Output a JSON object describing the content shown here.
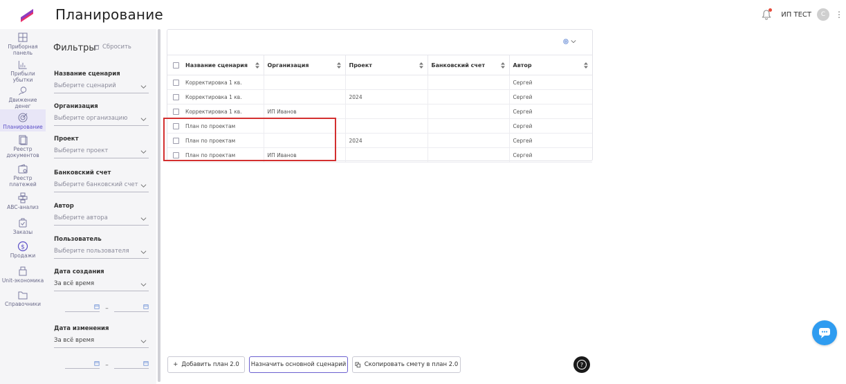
{
  "header": {
    "title": "Планирование",
    "user_name": "ИП ТЕСТ",
    "avatar_letter": "С"
  },
  "nav": {
    "items": [
      {
        "label": "Приборная панель",
        "icon": "dashboard-icon"
      },
      {
        "label": "Прибыли убытки",
        "icon": "chart-icon"
      },
      {
        "label": "Движение денег",
        "icon": "money-flow-icon"
      },
      {
        "label": "Планирование",
        "icon": "target-icon",
        "active": true
      },
      {
        "label": "Реестр документов",
        "icon": "documents-icon"
      },
      {
        "label": "Реестр платежей",
        "icon": "wallet-icon"
      },
      {
        "label": "ABC-анализ",
        "icon": "abc-icon"
      },
      {
        "label": "Заказы",
        "icon": "orders-icon"
      },
      {
        "label": "Продажи",
        "icon": "dollar-icon"
      },
      {
        "label": "Unit-экономика",
        "icon": "unit-icon"
      },
      {
        "label": "Справочники",
        "icon": "folder-icon"
      }
    ]
  },
  "filters": {
    "title": "Фильтры",
    "reset_label": "Сбросить",
    "scenario": {
      "label": "Название сценария",
      "placeholder": "Выберите сценарий"
    },
    "organization": {
      "label": "Организация",
      "placeholder": "Выберите организацию"
    },
    "project": {
      "label": "Проект",
      "placeholder": "Выберите проект"
    },
    "bank_account": {
      "label": "Банковский счет",
      "placeholder": "Выберите банковский счет"
    },
    "author": {
      "label": "Автор",
      "placeholder": "Выберите автора"
    },
    "user": {
      "label": "Пользователь",
      "placeholder": "Выберите пользователя"
    },
    "created": {
      "label": "Дата создания",
      "value": "За всё время",
      "dash": "–"
    },
    "modified": {
      "label": "Дата изменения",
      "value": "За всё время",
      "dash": "–"
    }
  },
  "table": {
    "columns": [
      "Название сценария",
      "Организация",
      "Проект",
      "Банковский счет",
      "Автор"
    ],
    "rows": [
      {
        "name": "Корректировка 1 кв.",
        "org": "",
        "project": "",
        "bank": "",
        "author": "Сергей"
      },
      {
        "name": "Корректировка 1 кв.",
        "org": "",
        "project": "2024",
        "bank": "",
        "author": "Сергей"
      },
      {
        "name": "Корректировка 1 кв.",
        "org": "ИП Иванов",
        "project": "",
        "bank": "",
        "author": "Сергей"
      },
      {
        "name": "План по проектам",
        "org": "",
        "project": "",
        "bank": "",
        "author": "Сергей"
      },
      {
        "name": "План по проектам",
        "org": "",
        "project": "2024",
        "bank": "",
        "author": "Сергей"
      },
      {
        "name": "План по проектам",
        "org": "ИП Иванов",
        "project": "",
        "bank": "",
        "author": "Сергей"
      }
    ]
  },
  "actions": {
    "add_plan": "Добавить план 2.0",
    "add_plan_plus": "+",
    "set_main": "Назначить основной сценарий",
    "copy_estimate": "Скопировать смету в план 2.0",
    "help_glyph": "?"
  },
  "colors": {
    "accent": "#5b4fc7",
    "highlight": "#d32f2f",
    "chat": "#2f9cf0"
  }
}
